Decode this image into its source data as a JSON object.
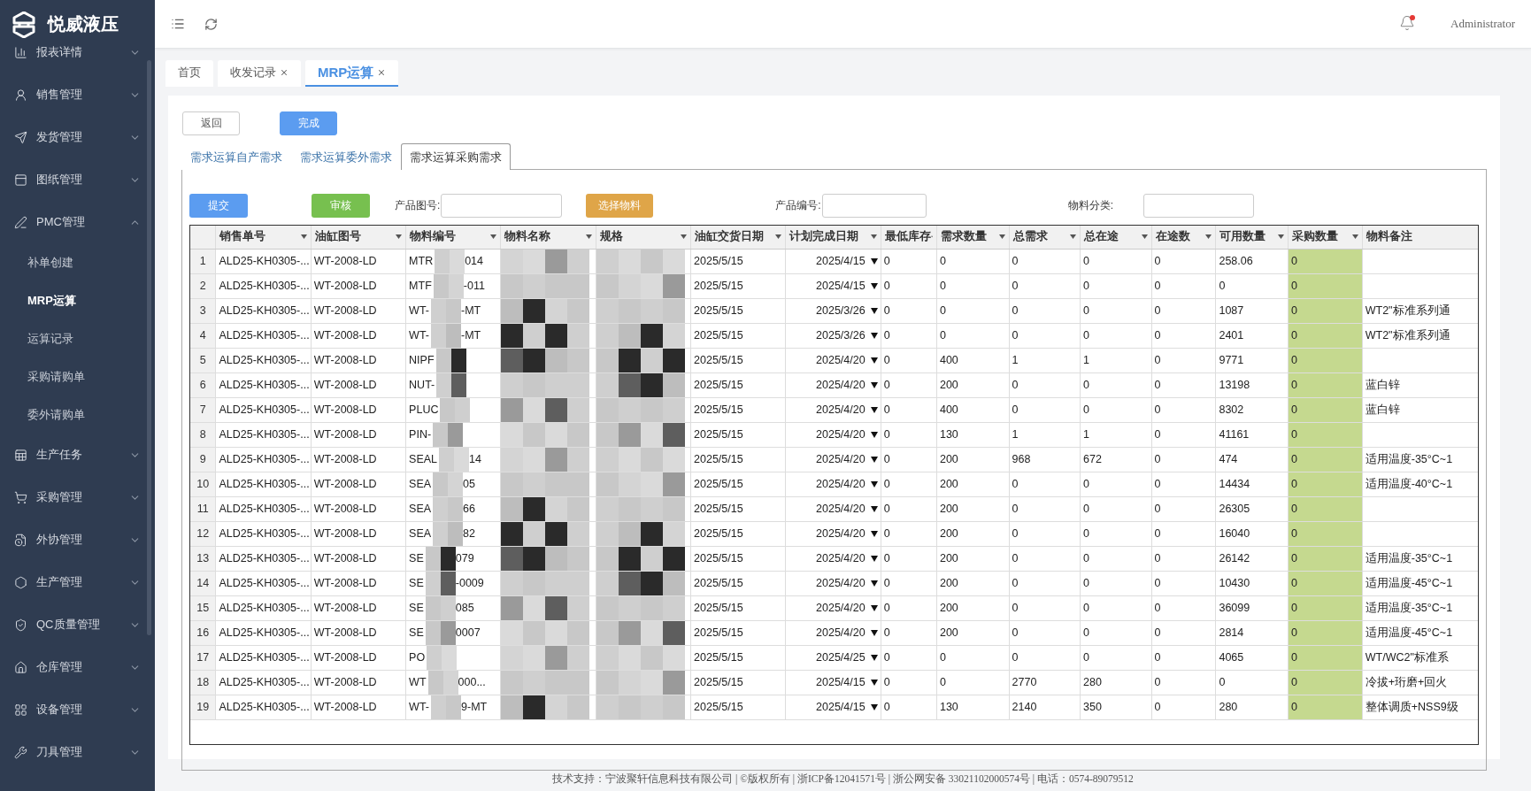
{
  "app": {
    "logo_text": "悦威液压"
  },
  "sidebar": {
    "items": [
      {
        "label": "报表详情",
        "expanded": false
      },
      {
        "label": "销售管理",
        "expanded": false
      },
      {
        "label": "发货管理",
        "expanded": false
      },
      {
        "label": "图纸管理",
        "expanded": false
      },
      {
        "label": "PMC管理",
        "expanded": true,
        "children": [
          {
            "label": "补单创建",
            "selected": false
          },
          {
            "label": "MRP运算",
            "selected": true
          },
          {
            "label": "运算记录",
            "selected": false
          },
          {
            "label": "采购请购单",
            "selected": false
          },
          {
            "label": "委外请购单",
            "selected": false
          }
        ]
      },
      {
        "label": "生产任务",
        "expanded": false
      },
      {
        "label": "采购管理",
        "expanded": false
      },
      {
        "label": "外协管理",
        "expanded": false
      },
      {
        "label": "生产管理",
        "expanded": false
      },
      {
        "label": "QC质量管理",
        "expanded": false
      },
      {
        "label": "仓库管理",
        "expanded": false
      },
      {
        "label": "设备管理",
        "expanded": false
      },
      {
        "label": "刀具管理",
        "expanded": false
      }
    ]
  },
  "header": {
    "user": "Administrator",
    "notification_dot": true
  },
  "tabs": [
    {
      "label": "首页",
      "selected": false,
      "closable": false
    },
    {
      "label": "收发记录",
      "selected": false,
      "closable": true
    },
    {
      "label": "MRP运算",
      "selected": true,
      "closable": true
    }
  ],
  "actions": [
    {
      "label": "返回",
      "kind": "plain"
    },
    {
      "label": "完成",
      "kind": "primary"
    }
  ],
  "sub_tabs": [
    {
      "label": "需求运算自产需求",
      "selected": false
    },
    {
      "label": "需求运算委外需求",
      "selected": false
    },
    {
      "label": "需求运算采购需求",
      "selected": true
    }
  ],
  "toolbar": [
    {
      "kind": "button",
      "label": "提交",
      "color": "#5b9cf0"
    },
    {
      "kind": "button",
      "label": "审核",
      "color": "#77c04f"
    },
    {
      "kind": "field",
      "label": "产品图号:"
    },
    {
      "kind": "button",
      "label": "选择物料",
      "color": "#dfa548"
    },
    {
      "kind": "field",
      "label": "产品编号:"
    },
    {
      "kind": "field",
      "label": "物料分类:"
    }
  ],
  "table": {
    "columns": [
      "销售单号",
      "油缸图号",
      "物料编号",
      "物料名称",
      "规格",
      "油缸交货日期",
      "计划完成日期",
      "最低库存",
      "需求数量",
      "总需求",
      "总在途",
      "在途数",
      "可用数量",
      "采购数量",
      "物料备注"
    ],
    "rows": [
      {
        "no": "1",
        "order": "ALD25-KH0305-...",
        "drawing": "WT-2008-LD",
        "code_start": "MTR",
        "code_end": "014",
        "delivery": "2025/5/15",
        "plan": "2025/4/15",
        "min": "0",
        "demand": "0",
        "total_demand": "0",
        "total_transit": "0",
        "transit": "0",
        "available": "258.06",
        "purchase": "0"
      },
      {
        "no": "2",
        "order": "ALD25-KH0305-...",
        "drawing": "WT-2008-LD",
        "code_start": "MTF",
        "code_end": "-011",
        "delivery": "2025/5/15",
        "plan": "2025/4/15",
        "min": "0",
        "demand": "0",
        "total_demand": "0",
        "total_transit": "0",
        "transit": "0",
        "available": "0",
        "purchase": "0"
      },
      {
        "no": "3",
        "order": "ALD25-KH0305-...",
        "drawing": "WT-2008-LD",
        "code_start": "WT-",
        "code_end": "-MT",
        "delivery": "2025/5/15",
        "plan": "2025/3/26",
        "min": "0",
        "demand": "0",
        "total_demand": "0",
        "total_transit": "0",
        "transit": "0",
        "available": "1087",
        "purchase": "0",
        "remark": "WT2\"标准系列通"
      },
      {
        "no": "4",
        "order": "ALD25-KH0305-...",
        "drawing": "WT-2008-LD",
        "code_start": "WT-",
        "code_end": "-MT",
        "delivery": "2025/5/15",
        "plan": "2025/3/26",
        "min": "0",
        "demand": "0",
        "total_demand": "0",
        "total_transit": "0",
        "transit": "0",
        "available": "2401",
        "purchase": "0",
        "remark": "WT2\"标准系列通"
      },
      {
        "no": "5",
        "order": "ALD25-KH0305-...",
        "drawing": "WT-2008-LD",
        "code_start": "NIPF",
        "delivery": "2025/5/15",
        "plan": "2025/4/20",
        "min": "0",
        "demand": "400",
        "total_demand": "1",
        "total_transit": "1",
        "transit": "0",
        "available": "9771",
        "purchase": "0"
      },
      {
        "no": "6",
        "order": "ALD25-KH0305-...",
        "drawing": "WT-2008-LD",
        "code_start": "NUT-",
        "delivery": "2025/5/15",
        "plan": "2025/4/20",
        "min": "0",
        "demand": "200",
        "total_demand": "0",
        "total_transit": "0",
        "transit": "0",
        "available": "13198",
        "purchase": "0",
        "remark": "蓝白锌"
      },
      {
        "no": "7",
        "order": "ALD25-KH0305-...",
        "drawing": "WT-2008-LD",
        "code_start": "PLUC",
        "delivery": "2025/5/15",
        "plan": "2025/4/20",
        "min": "0",
        "demand": "400",
        "total_demand": "0",
        "total_transit": "0",
        "transit": "0",
        "available": "8302",
        "purchase": "0",
        "remark": "蓝白锌"
      },
      {
        "no": "8",
        "order": "ALD25-KH0305-...",
        "drawing": "WT-2008-LD",
        "code_start": "PIN-",
        "delivery": "2025/5/15",
        "plan": "2025/4/20",
        "min": "0",
        "demand": "130",
        "total_demand": "1",
        "total_transit": "1",
        "transit": "0",
        "available": "41161",
        "purchase": "0"
      },
      {
        "no": "9",
        "order": "ALD25-KH0305-...",
        "drawing": "WT-2008-LD",
        "code_start": "SEAL",
        "code_end": "14",
        "delivery": "2025/5/15",
        "plan": "2025/4/20",
        "min": "0",
        "demand": "200",
        "total_demand": "968",
        "total_transit": "672",
        "transit": "0",
        "available": "474",
        "purchase": "0",
        "remark": "适用温度-35°C~1"
      },
      {
        "no": "10",
        "order": "ALD25-KH0305-...",
        "drawing": "WT-2008-LD",
        "code_start": "SEA",
        "code_end": "05",
        "delivery": "2025/5/15",
        "plan": "2025/4/20",
        "min": "0",
        "demand": "200",
        "total_demand": "0",
        "total_transit": "0",
        "transit": "0",
        "available": "14434",
        "purchase": "0",
        "remark": "适用温度-40°C~1"
      },
      {
        "no": "11",
        "order": "ALD25-KH0305-...",
        "drawing": "WT-2008-LD",
        "code_start": "SEA",
        "code_end": "66",
        "delivery": "2025/5/15",
        "plan": "2025/4/20",
        "min": "0",
        "demand": "200",
        "total_demand": "0",
        "total_transit": "0",
        "transit": "0",
        "available": "26305",
        "purchase": "0"
      },
      {
        "no": "12",
        "order": "ALD25-KH0305-...",
        "drawing": "WT-2008-LD",
        "code_start": "SEA",
        "code_end": "82",
        "delivery": "2025/5/15",
        "plan": "2025/4/20",
        "min": "0",
        "demand": "200",
        "total_demand": "0",
        "total_transit": "0",
        "transit": "0",
        "available": "16040",
        "purchase": "0"
      },
      {
        "no": "13",
        "order": "ALD25-KH0305-...",
        "drawing": "WT-2008-LD",
        "code_start": "SE",
        "code_end": "079",
        "delivery": "2025/5/15",
        "plan": "2025/4/20",
        "min": "0",
        "demand": "200",
        "total_demand": "0",
        "total_transit": "0",
        "transit": "0",
        "available": "26142",
        "purchase": "0",
        "remark": "适用温度-35°C~1"
      },
      {
        "no": "14",
        "order": "ALD25-KH0305-...",
        "drawing": "WT-2008-LD",
        "code_start": "SE",
        "code_end": "-0009",
        "delivery": "2025/5/15",
        "plan": "2025/4/20",
        "min": "0",
        "demand": "200",
        "total_demand": "0",
        "total_transit": "0",
        "transit": "0",
        "available": "10430",
        "purchase": "0",
        "remark": "适用温度-45°C~1"
      },
      {
        "no": "15",
        "order": "ALD25-KH0305-...",
        "drawing": "WT-2008-LD",
        "code_start": "SE",
        "code_end": "085",
        "delivery": "2025/5/15",
        "plan": "2025/4/20",
        "min": "0",
        "demand": "200",
        "total_demand": "0",
        "total_transit": "0",
        "transit": "0",
        "available": "36099",
        "purchase": "0",
        "remark": "适用温度-35°C~1"
      },
      {
        "no": "16",
        "order": "ALD25-KH0305-...",
        "drawing": "WT-2008-LD",
        "code_start": "SE",
        "code_end": "0007",
        "delivery": "2025/5/15",
        "plan": "2025/4/20",
        "min": "0",
        "demand": "200",
        "total_demand": "0",
        "total_transit": "0",
        "transit": "0",
        "available": "2814",
        "purchase": "0",
        "remark": "适用温度-45°C~1"
      },
      {
        "no": "17",
        "order": "ALD25-KH0305-...",
        "drawing": "WT-2008-LD",
        "code_start": "PO",
        "delivery": "2025/5/15",
        "plan": "2025/4/25",
        "min": "0",
        "demand": "0",
        "total_demand": "0",
        "total_transit": "0",
        "transit": "0",
        "available": "4065",
        "purchase": "0",
        "remark": "WT/WC2\"标准系"
      },
      {
        "no": "18",
        "order": "ALD25-KH0305-...",
        "drawing": "WT-2008-LD",
        "code_start": "WT",
        "code_end": "000...",
        "delivery": "2025/5/15",
        "plan": "2025/4/15",
        "min": "0",
        "demand": "0",
        "total_demand": "2770",
        "total_transit": "280",
        "transit": "0",
        "available": "0",
        "purchase": "0",
        "remark": "冷拔+珩磨+回火"
      },
      {
        "no": "19",
        "order": "ALD25-KH0305-...",
        "drawing": "WT-2008-LD",
        "code_start": "WT-",
        "code_end": "9-MT",
        "delivery": "2025/5/15",
        "plan": "2025/4/15",
        "min": "0",
        "demand": "130",
        "total_demand": "2140",
        "total_transit": "350",
        "transit": "0",
        "available": "280",
        "purchase": "0",
        "remark": "整体调质+NSS9级"
      }
    ]
  },
  "footer": "技术支持：宁波聚轩信息科技有限公司 | ©版权所有 | 浙ICP备12041571号 | 浙公网安备 33021102000574号 | 电话：0574-89079512"
}
